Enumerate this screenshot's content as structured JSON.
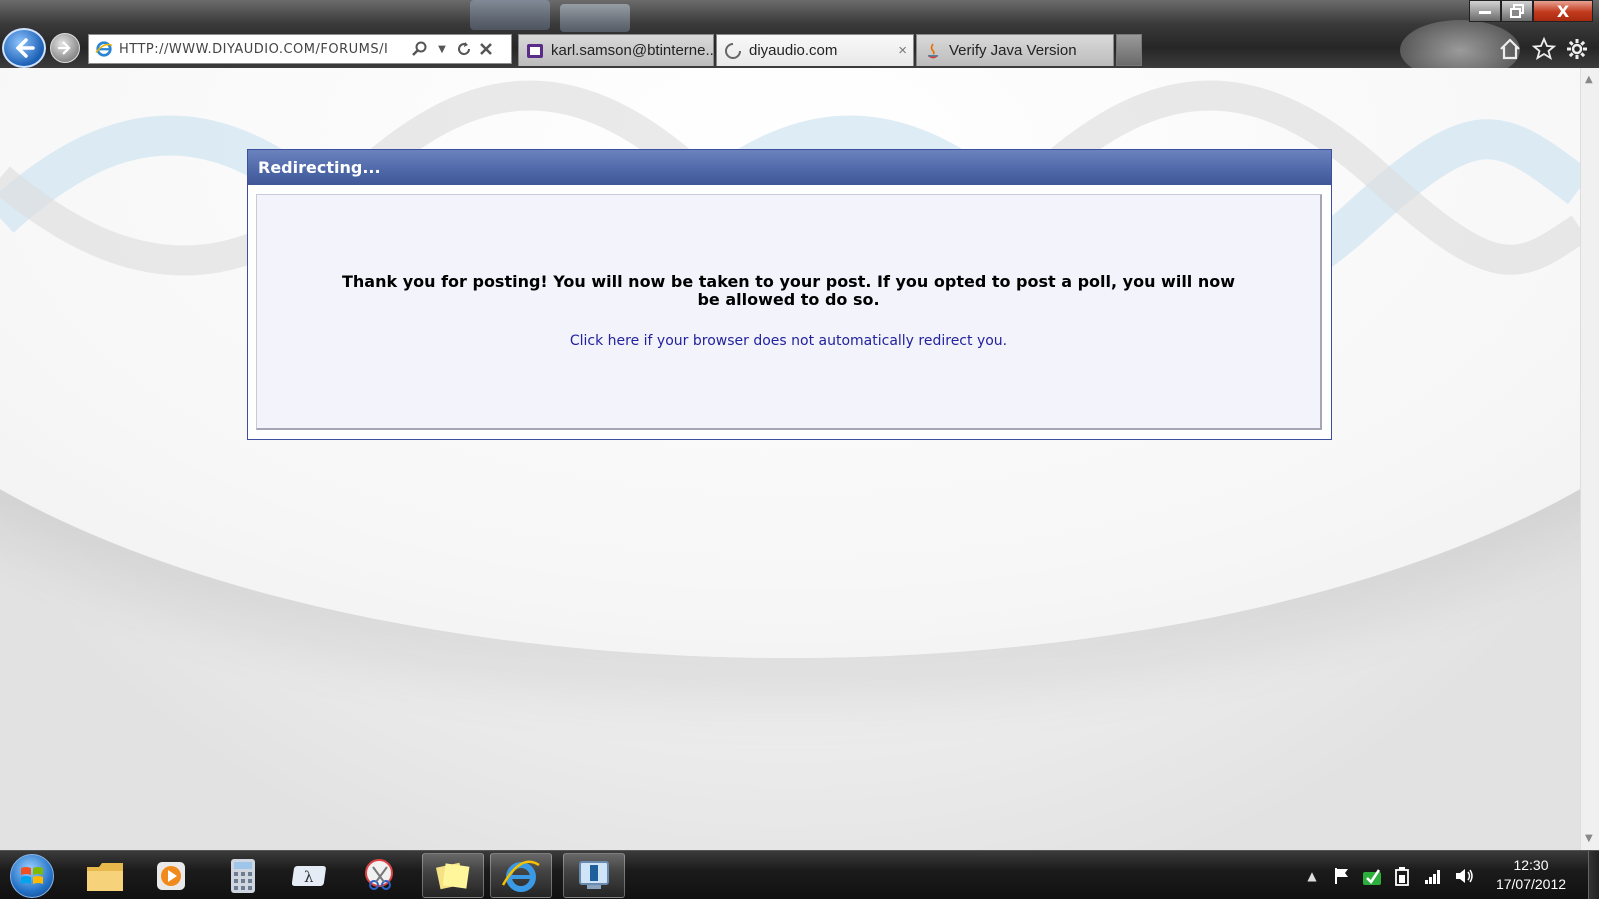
{
  "browser": {
    "address_url": "HTTP://WWW.DIYAUDIO.COM/FORUMS/I",
    "tabs": [
      {
        "label": "karl.samson@btinterne...",
        "icon": "yahoo-mail-icon",
        "active": false
      },
      {
        "label": "diyaudio.com",
        "icon": "loading-spinner-icon",
        "active": true,
        "close": "×"
      },
      {
        "label": "Verify Java Version",
        "icon": "java-icon",
        "active": false
      }
    ],
    "window_close": "X"
  },
  "page": {
    "header_title": "Redirecting...",
    "message": "Thank you for posting! You will now be taken to your post. If you opted to post a poll, you will now be allowed to do so.",
    "link_text": "Click here if your browser does not automatically redirect you.",
    "header_color": "#4e67a8",
    "link_color": "#22229c"
  },
  "taskbar": {
    "apps": [
      {
        "name": "windows-explorer-icon",
        "running": false
      },
      {
        "name": "media-player-icon",
        "running": false
      },
      {
        "name": "calculator-icon",
        "running": false
      },
      {
        "name": "math-input-icon",
        "running": false
      },
      {
        "name": "snipping-tool-icon",
        "running": false
      },
      {
        "name": "sticky-notes-icon",
        "running": true
      },
      {
        "name": "internet-explorer-icon",
        "running": true
      },
      {
        "name": "remote-desktop-icon",
        "running": true
      }
    ],
    "clock_time": "12:30",
    "clock_date": "17/07/2012"
  }
}
